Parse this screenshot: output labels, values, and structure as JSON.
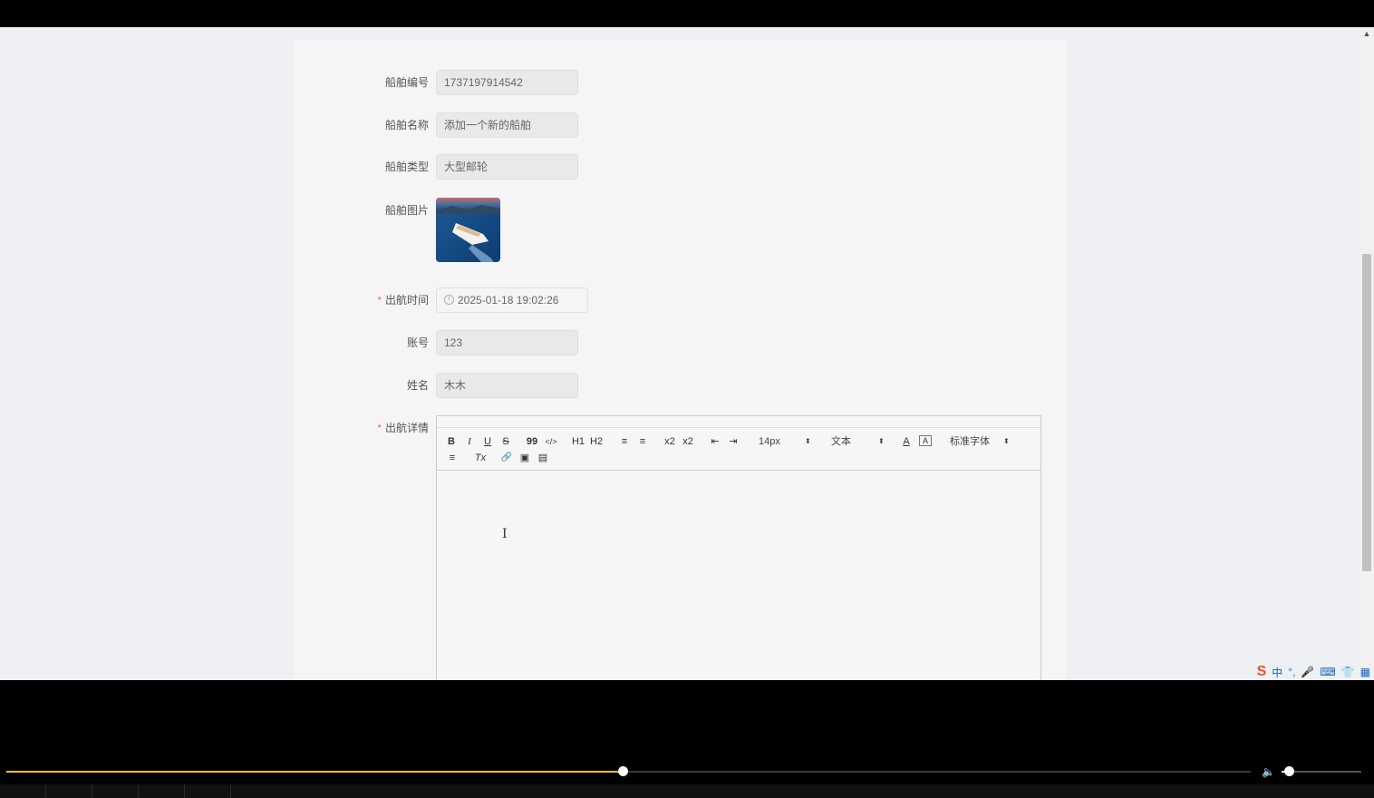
{
  "form": {
    "ship_no": {
      "label": "船舶编号",
      "value": "1737197914542"
    },
    "ship_name": {
      "label": "船舶名称",
      "value": "添加一个新的船舶"
    },
    "ship_type": {
      "label": "船舶类型",
      "value": "大型邮轮"
    },
    "ship_image": {
      "label": "船舶图片"
    },
    "depart_time": {
      "label": "出航时间",
      "required_mark": "*",
      "value": "2025-01-18 19:02:26"
    },
    "account": {
      "label": "账号",
      "value": "123"
    },
    "name": {
      "label": "姓名",
      "value": "木木"
    },
    "details": {
      "label": "出航详情",
      "required_mark": "*"
    }
  },
  "editor": {
    "toolbar": {
      "bold": "B",
      "italic": "I",
      "underline": "U",
      "strike": "S",
      "blockquote": "99",
      "code": "</>",
      "h1": "H1",
      "h2": "H2",
      "ordered_list": "≡",
      "bullet_list": "≡",
      "subscript": "x2",
      "superscript": "x2",
      "indent_less": "⇤",
      "indent_more": "⇥",
      "size_value": "14px",
      "header_value": "文本",
      "font_value": "标准字体",
      "color": "A",
      "background": "A",
      "align": "≡",
      "clean": "Tx",
      "link": "🔗",
      "image": "▣",
      "video": "▤"
    },
    "cursor": "I"
  },
  "ime": {
    "logo": "S",
    "mode": "中",
    "punct": "°,",
    "mic": "🎤",
    "keyboard": "⌨",
    "skin": "👕",
    "grid": "▦"
  },
  "player": {
    "progress": 0.495,
    "volume": 0.09
  },
  "scroll": {
    "up_arrow": "▲"
  }
}
